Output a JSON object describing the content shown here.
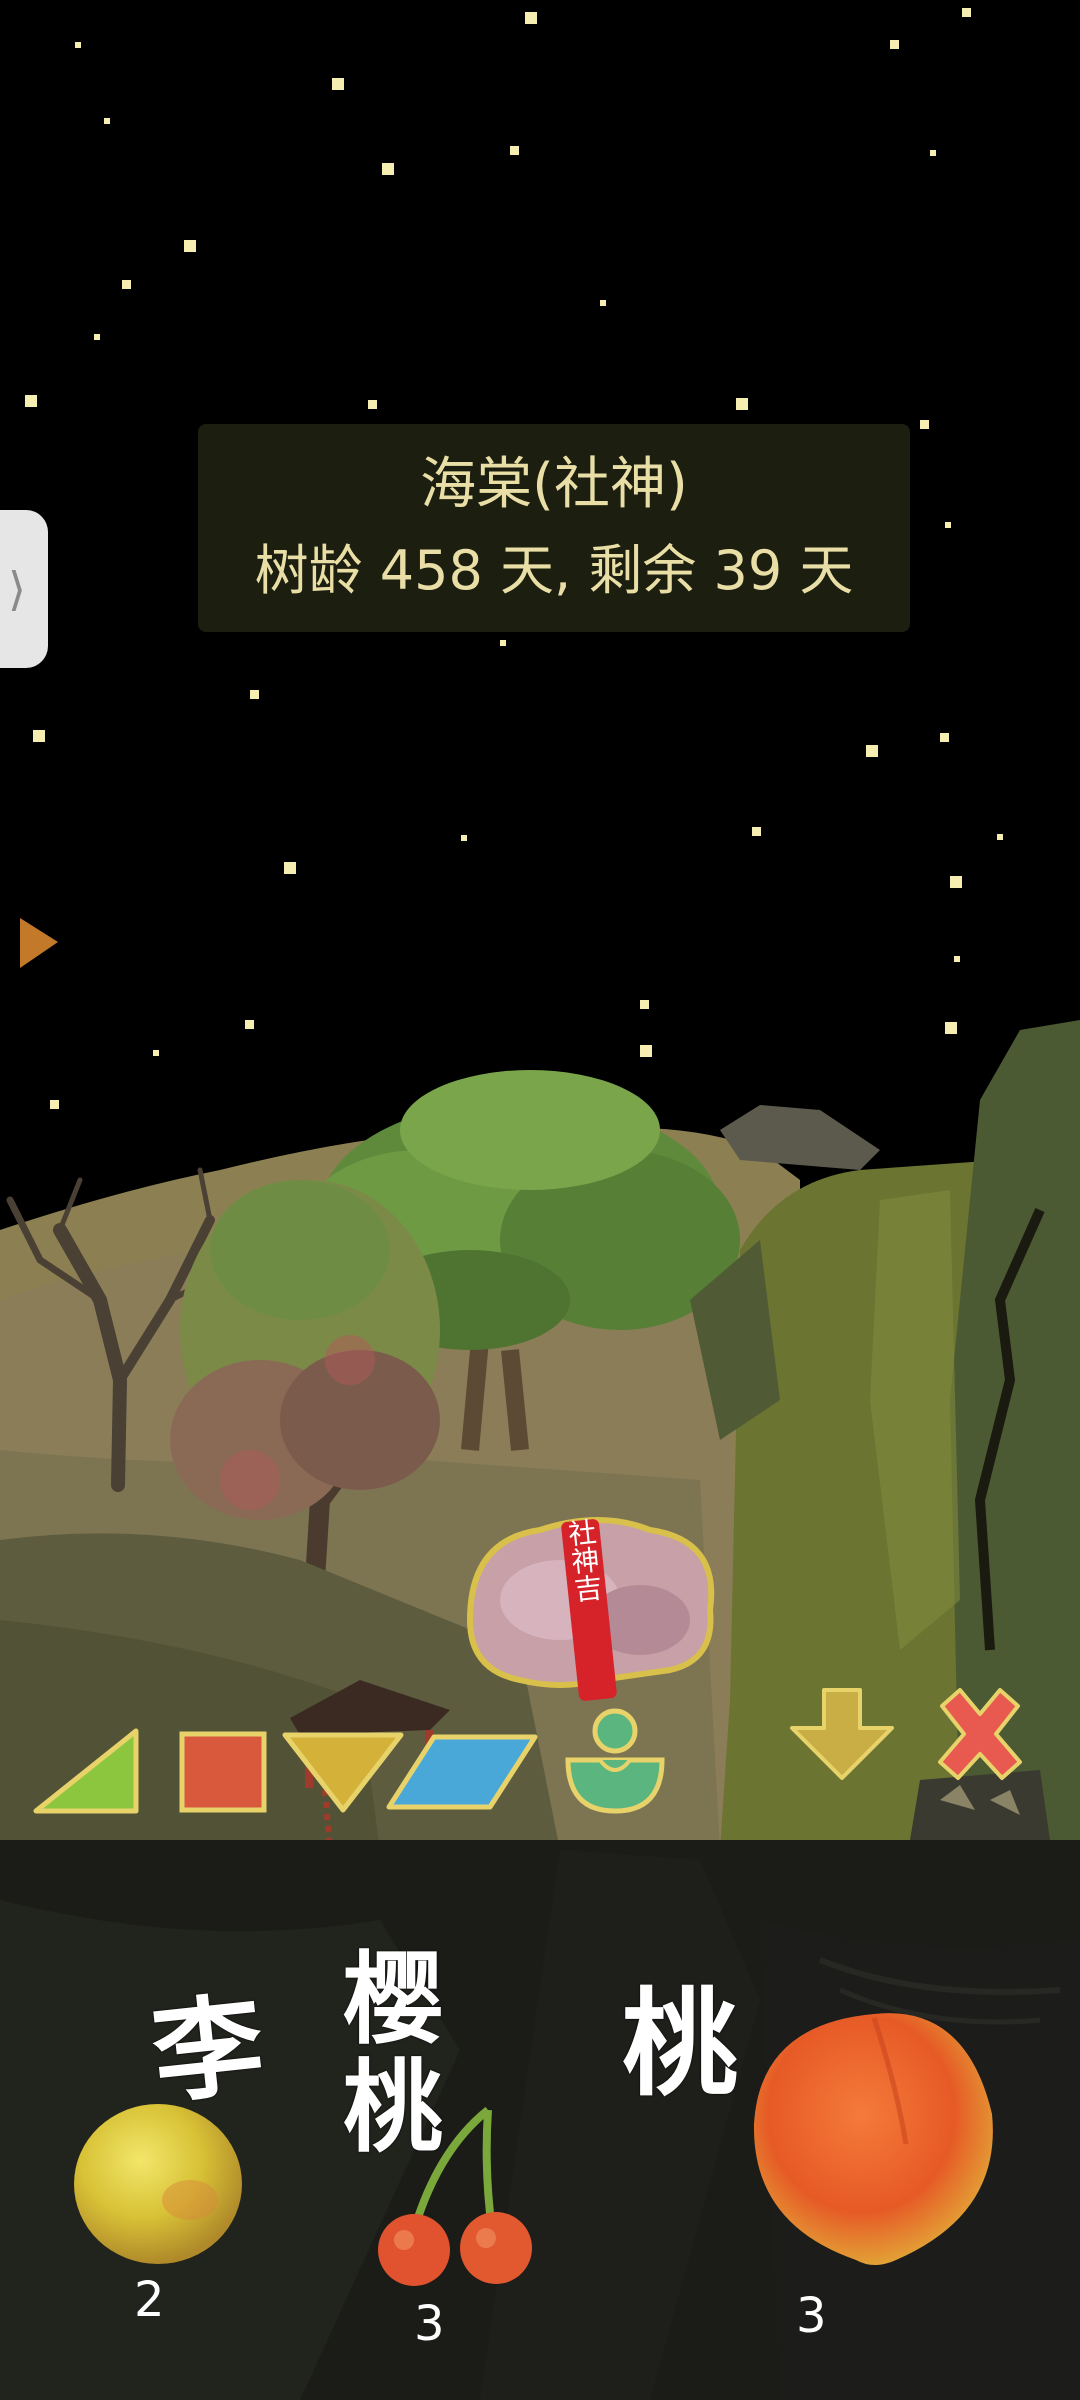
{
  "tree_info": {
    "name": "海棠(社神)",
    "age_text": "树龄 458 天, 剩余 39 天"
  },
  "side_tab": {
    "icon": "chevron-right-icon",
    "glyph": "⟩"
  },
  "scene": {
    "left_marker_icon": "play-triangle-icon",
    "charm_text": "社神吉"
  },
  "toolbar": {
    "shapes": [
      {
        "name": "triangle-icon",
        "color": "#8cc63f"
      },
      {
        "name": "square-icon",
        "color": "#d9593d"
      },
      {
        "name": "inverted-triangle-icon",
        "color": "#d4b23a"
      },
      {
        "name": "parallelogram-icon",
        "color": "#4aa8d8"
      },
      {
        "name": "figure-icon",
        "color": "#5bb57e"
      }
    ],
    "actions": [
      {
        "name": "down-arrow-icon",
        "color": "#c9ad45"
      },
      {
        "name": "close-x-icon",
        "color": "#e85a4f"
      }
    ]
  },
  "fruits": [
    {
      "label": "李",
      "count": "2"
    },
    {
      "label": "樱桃",
      "count": "3"
    },
    {
      "label": "桃",
      "count": "3"
    }
  ]
}
